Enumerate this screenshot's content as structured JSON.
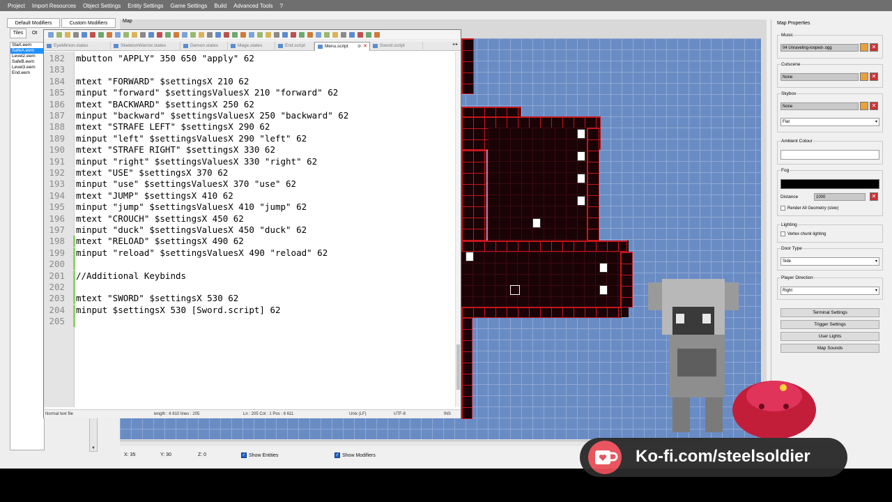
{
  "menubar": [
    "Project",
    "Import Resources",
    "Object Settings",
    "Entity Settings",
    "Game Settings",
    "Build",
    "Advanced Tools",
    "?"
  ],
  "left_panel": {
    "tabs": [
      "Default Modifiers",
      "Custom Modifiers"
    ],
    "subtabs": [
      "Tiles",
      "Ot"
    ],
    "files": [
      "Start.eem",
      "SafeA.eem",
      "Level2.eem",
      "SafeB.eem",
      "Level3.eem",
      "End.eem"
    ],
    "selected_index": 1
  },
  "map": {
    "label": "Map"
  },
  "editor": {
    "tabs": [
      {
        "label": "EyeMinion.states",
        "active": false
      },
      {
        "label": "SkeletonWarrior.states",
        "active": false
      },
      {
        "label": "Demon.states",
        "active": false
      },
      {
        "label": "Mage.states",
        "active": false
      },
      {
        "label": "End.script",
        "active": false
      },
      {
        "label": "Menu.script",
        "active": true
      },
      {
        "label": "Sword.script",
        "active": false
      }
    ],
    "nav": "◂ ▸",
    "lines": [
      {
        "n": "182",
        "t": "mbutton \"APPLY\" 350 650 \"apply\" 62"
      },
      {
        "n": "183",
        "t": ""
      },
      {
        "n": "184",
        "t": "mtext \"FORWARD\" $settingsX 210 62"
      },
      {
        "n": "185",
        "t": "minput \"forward\" $settingsValuesX 210 \"forward\" 62"
      },
      {
        "n": "186",
        "t": "mtext \"BACKWARD\" $settingsX 250 62"
      },
      {
        "n": "187",
        "t": "minput \"backward\" $settingsValuesX 250 \"backward\" 62"
      },
      {
        "n": "188",
        "t": "mtext \"STRAFE LEFT\" $settingsX 290 62"
      },
      {
        "n": "189",
        "t": "minput \"left\" $settingsValuesX 290 \"left\" 62"
      },
      {
        "n": "190",
        "t": "mtext \"STRAFE RIGHT\" $settingsX 330 62"
      },
      {
        "n": "191",
        "t": "minput \"right\" $settingsValuesX 330 \"right\" 62"
      },
      {
        "n": "192",
        "t": "mtext \"USE\" $settingsX 370 62"
      },
      {
        "n": "193",
        "t": "minput \"use\" $settingsValuesX 370 \"use\" 62"
      },
      {
        "n": "194",
        "t": "mtext \"JUMP\" $settingsX 410 62"
      },
      {
        "n": "195",
        "t": "minput \"jump\" $settingsValuesX 410 \"jump\" 62"
      },
      {
        "n": "196",
        "t": "mtext \"CROUCH\" $settingsX 450 62"
      },
      {
        "n": "197",
        "t": "minput \"duck\" $settingsValuesX 450 \"duck\" 62"
      },
      {
        "n": "198",
        "t": "mtext \"RELOAD\" $settingsX 490 62"
      },
      {
        "n": "199",
        "t": "minput \"reload\" $settingsValuesX 490 \"reload\" 62"
      },
      {
        "n": "200",
        "t": ""
      },
      {
        "n": "201",
        "t": "//Additional Keybinds"
      },
      {
        "n": "202",
        "t": ""
      },
      {
        "n": "203",
        "t": "mtext \"SWORD\" $settingsX 530 62"
      },
      {
        "n": "204",
        "t": "minput $settingsX 530 [Sword.script] 62"
      },
      {
        "n": "205",
        "t": ""
      }
    ],
    "status": {
      "type": "Normal text file",
      "length": "length : 6 610    lines : 205",
      "pos": "Ln : 205    Col : 1    Pos : 6 611",
      "eol": "Unix (LF)",
      "enc": "UTF-8",
      "mode": "INS"
    }
  },
  "statusbar": {
    "x": "X: 35",
    "y": "Y: 30",
    "z": "Z: 0",
    "show_entities": "Show Entities",
    "show_modifiers": "Show Modifiers"
  },
  "properties": {
    "title": "Map Properties",
    "music_label": "Music",
    "music_value": "04 Unraveling-looped-.ogg",
    "cutscene_label": "Cutscene",
    "cutscene_value": "None",
    "skybox_label": "Skybox",
    "skybox_value": "None",
    "skybox_mode": "Flat",
    "ambient_label": "Ambient Colour",
    "fog_label": "Fog",
    "distance_label": "Distance",
    "distance_value": "1000",
    "render_all": "Render All Geometry (slow)",
    "lighting_label": "Lighting",
    "vertex_chunk": "Vertex chunk lighting",
    "door_type_label": "Door Type",
    "door_type_value": "Side",
    "player_dir_label": "Player Direction",
    "player_dir_value": "Right",
    "buttons": [
      "Terminal Settings",
      "Trigger Settings",
      "User Lights",
      "Map Sounds"
    ]
  },
  "kofi": {
    "text": "Ko-fi.com/steelsoldier"
  },
  "colors": {
    "wall_red": "#c8161b",
    "floor_dark": "#1a0306",
    "grid_blue": "#6a8cc5"
  }
}
